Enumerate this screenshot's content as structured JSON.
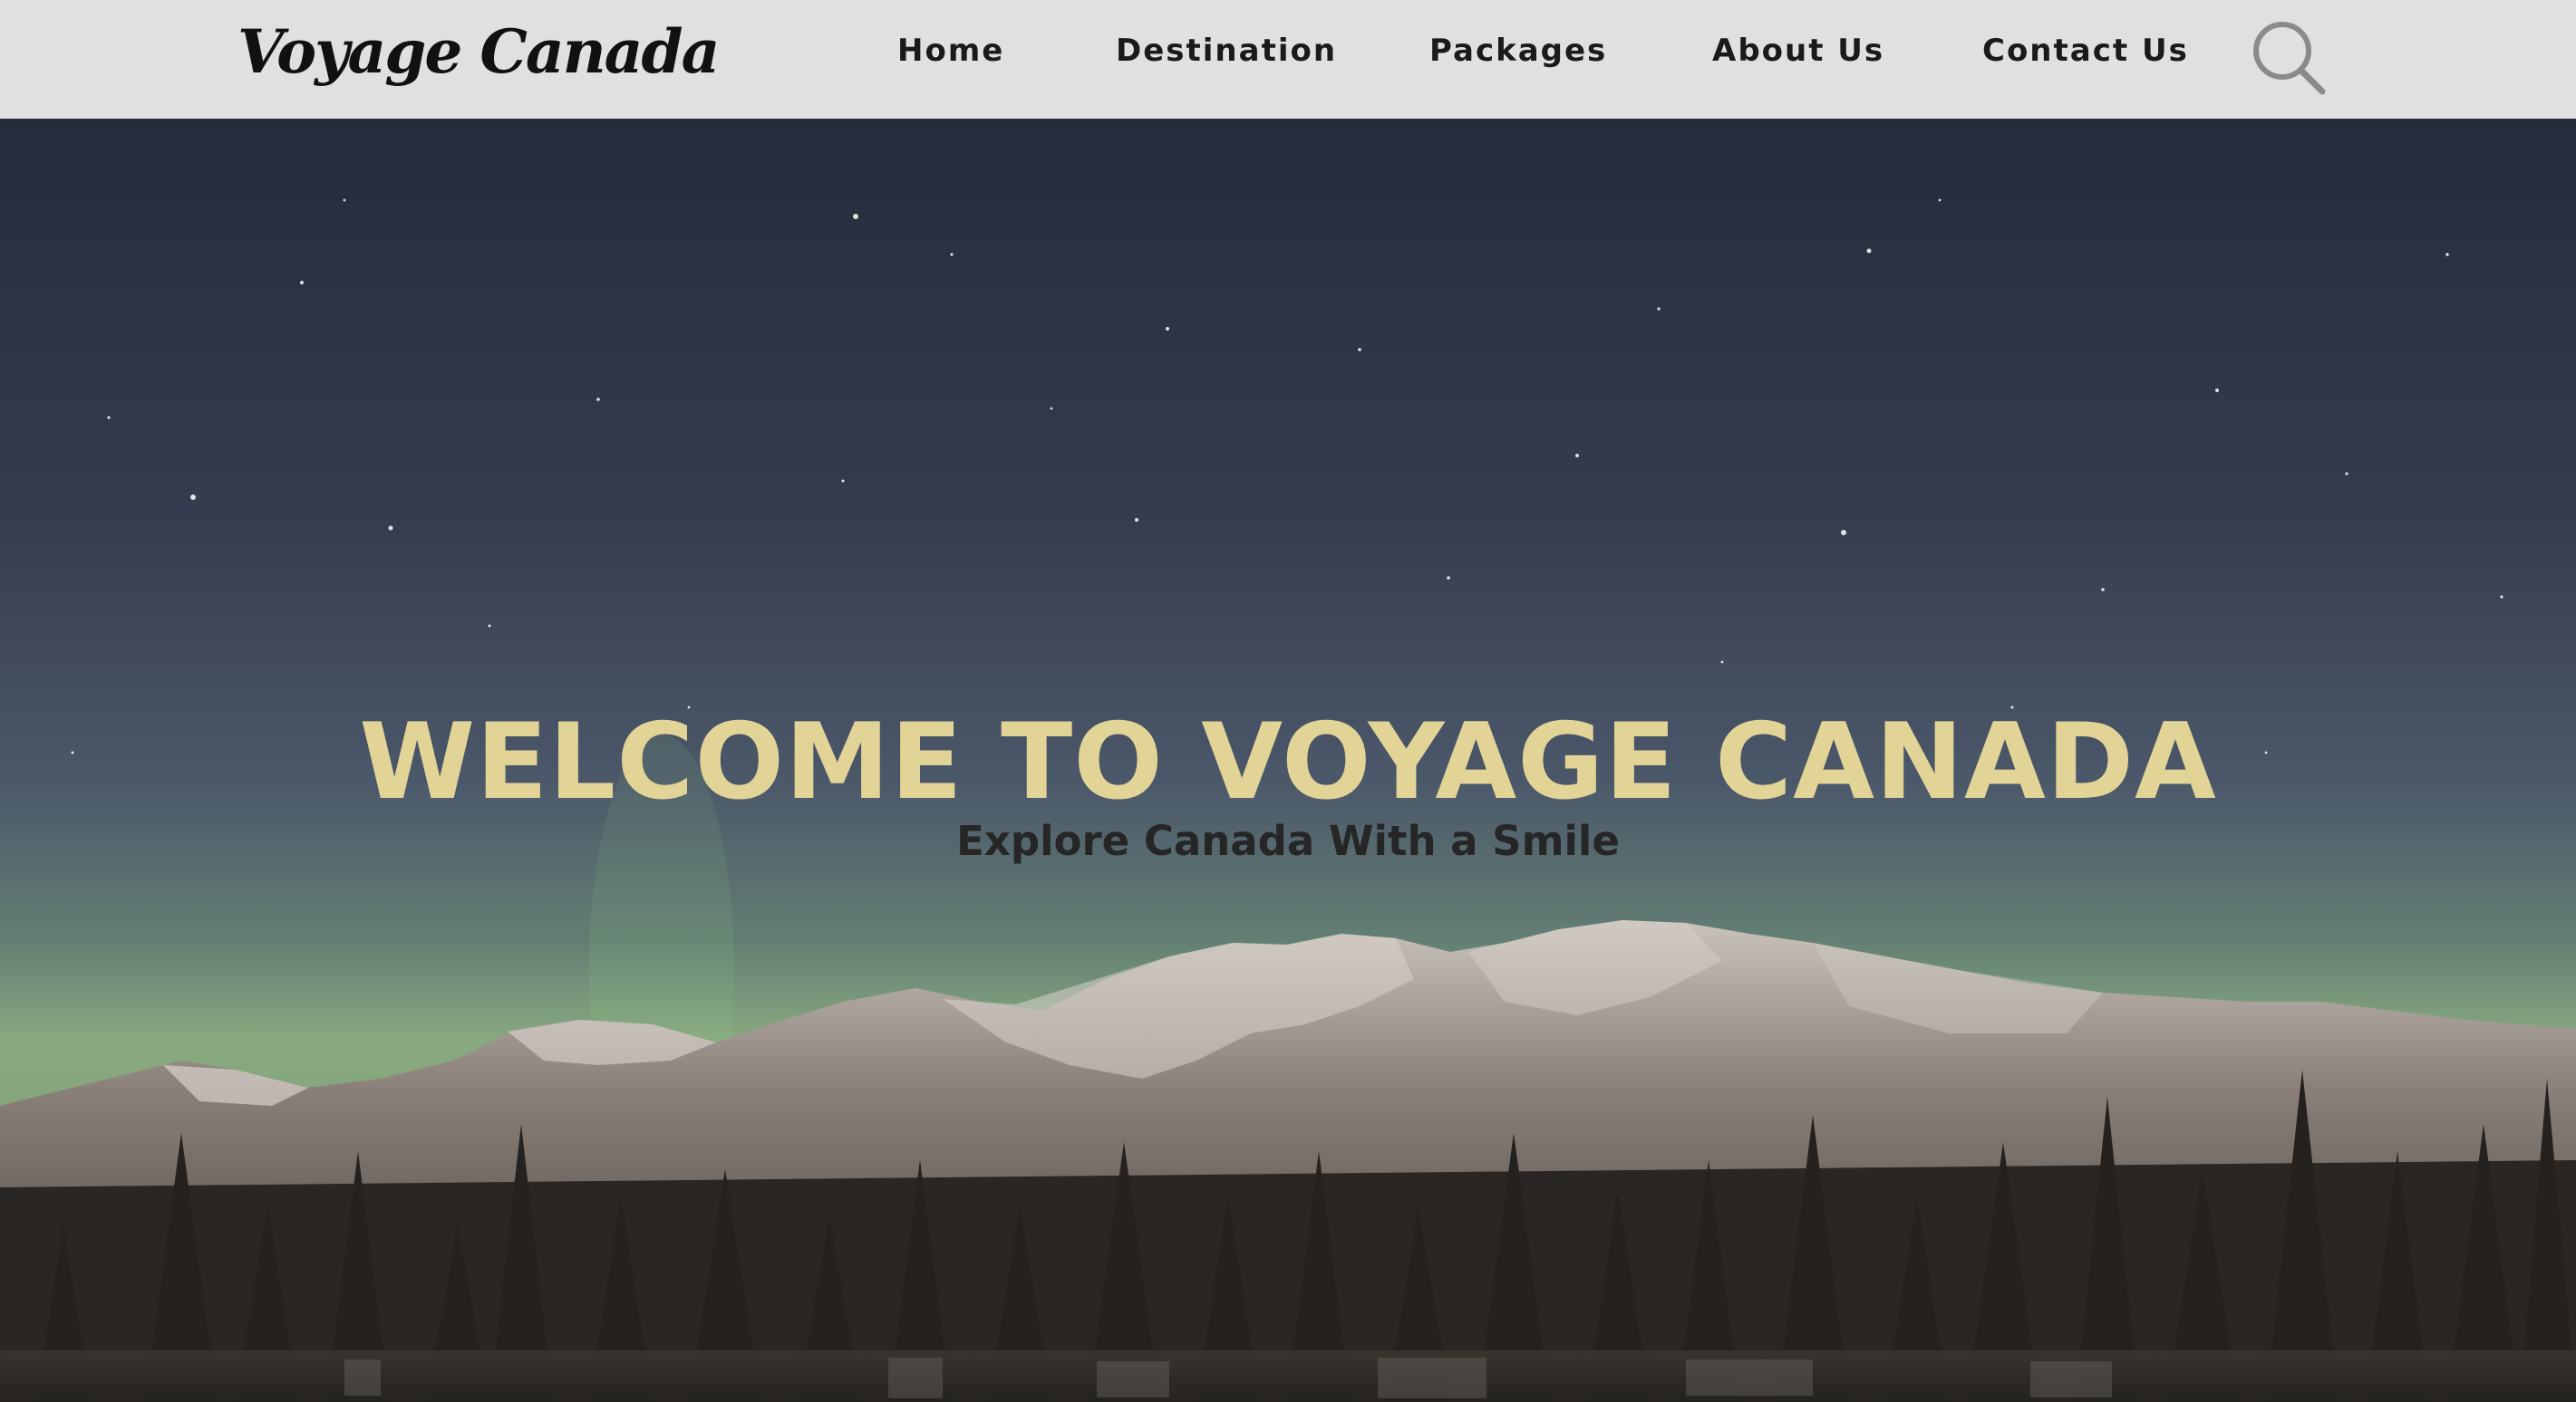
{
  "header": {
    "logo": "Voyage Canada",
    "nav": {
      "home": "Home",
      "destination": "Destination",
      "packages": "Packages",
      "about": "About Us",
      "contact": "Contact Us"
    },
    "search_icon": "search-icon"
  },
  "hero": {
    "title": "WELCOME TO VOYAGE CANADA",
    "subtitle": "Explore Canada With a Smile",
    "background": "night-sky-mountains-forest-aurora"
  },
  "colors": {
    "navbar_bg": "#e0e0e0",
    "title": "#e2d497",
    "subtitle": "#262626",
    "search_icon": "#8a8a8a"
  }
}
